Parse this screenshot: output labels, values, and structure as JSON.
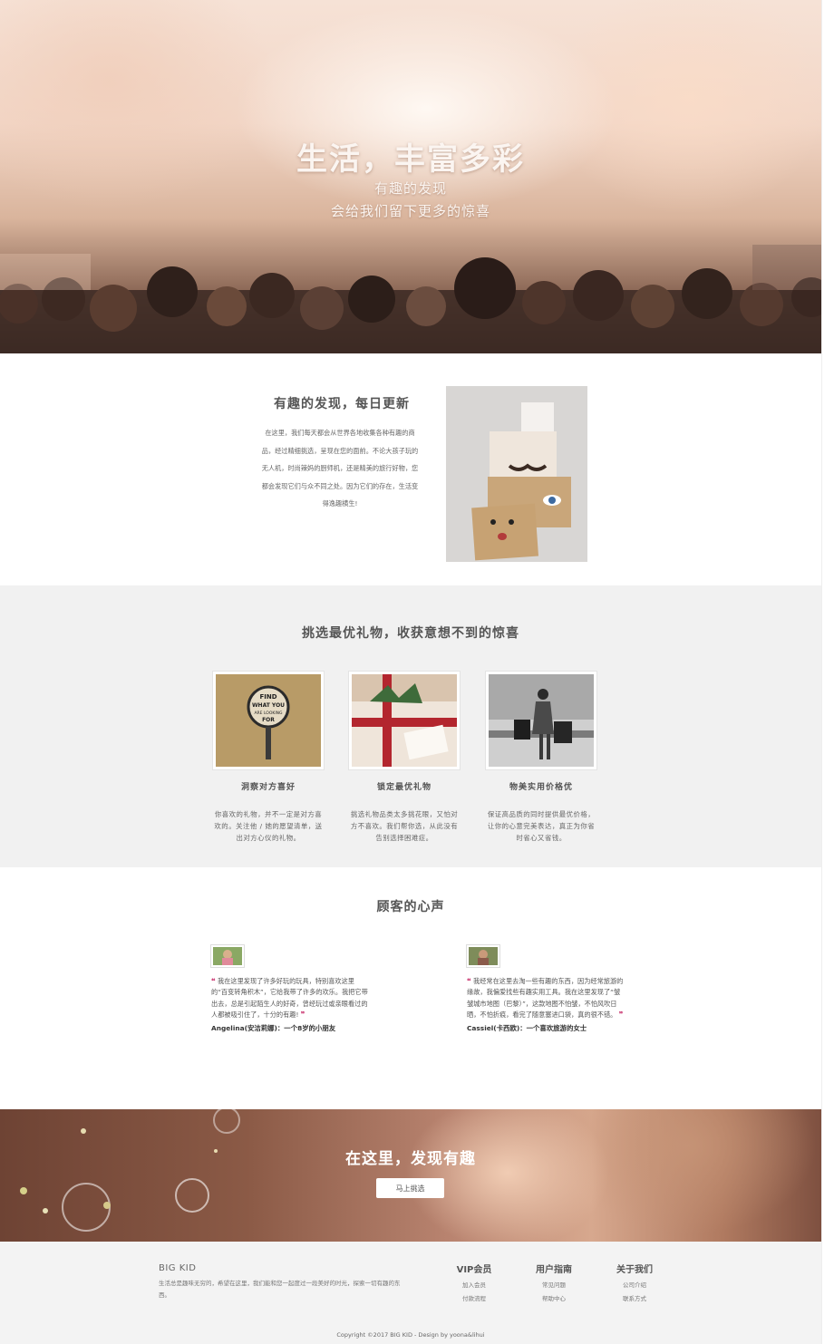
{
  "hero": {
    "title": "生活，丰富多彩",
    "subtitle_line1": "有趣的发现",
    "subtitle_line2": "会给我们留下更多的惊喜"
  },
  "daily": {
    "title": "有趣的发现，每日更新",
    "body": "在这里，我们每天都会从世界各地收集各种有趣的商品，经过精细挑选，呈现在您的面前。不论大孩子玩的无人机，时尚辣妈的厨师机，还是精美的旅行好物，您 都会发现它们与众不同之处。因为它们的存在，生活变得逸趣横生!"
  },
  "gifts": {
    "title": "挑选最优礼物，收获意想不到的惊喜",
    "cards": [
      {
        "title": "洞察对方喜好",
        "text": "你喜欢的礼物，并不一定是对方喜欢的。关注他 / 她的愿望清单，送出对方心仪的礼物。"
      },
      {
        "title": "锁定最优礼物",
        "text": "挑选礼物品类太多挑花眼，又怕对方不喜欢。我们帮你选，从此没有告别选择困难症。"
      },
      {
        "title": "物美实用价格优",
        "text": "保证高品质的同时提供最优价格，让你的心意完美表达，真正为你省时省心又省钱。"
      }
    ],
    "magnifier_text": [
      "FIND",
      "WHAT YOU",
      "ARE LOOKING",
      "FOR"
    ]
  },
  "voices": {
    "title": "顾客的心声",
    "items": [
      {
        "quote": "我在这里发现了许多好玩的玩具，特别喜欢这里的“百变转角积木”，它给我带了许多的欢乐。我把它带出去，总是引起陌生人的好奇，曾经玩过或亲眼看过的人都被吸引住了，十分的有趣!",
        "author": "Angelina(安洁莉娜)：一个8岁的小朋友"
      },
      {
        "quote": "我经常在这里去淘一些有趣的东西，因为经常旅游的缘故，我偏爱找些有趣实用工具。我在这里发现了“皱皱城市地图（巴黎）”，这款地图不怕皱，不怕风吹日晒，不怕折痕，看完了随意塞进口袋，真的很不错。",
        "author": "Cassiel(卡西欧)：一个喜欢旅游的女士"
      }
    ],
    "open_quote": "❝",
    "close_quote": "❞"
  },
  "cta": {
    "title": "在这里，发现有趣",
    "button_label": "马上挑选"
  },
  "footer": {
    "brand": "BIG KID",
    "brand_text": "生活总是趣味无穷的，希望在这里，我们能和您一起度过一段美好的时光，探索一切有趣的东西。",
    "columns": [
      {
        "title": "VIP会员",
        "links": [
          "加入会员",
          "付款流程"
        ]
      },
      {
        "title": "用户指南",
        "links": [
          "常见问题",
          "帮助中心"
        ]
      },
      {
        "title": "关于我们",
        "links": [
          "公司介绍",
          "联系方式"
        ]
      }
    ],
    "copyright": "Copyright ©2017 BIG KID - Design by yoona&lihui"
  },
  "colors": {
    "accent_quote": "#c2185b",
    "gray_section": "#f1f1f1",
    "footer_bg": "#f3f3f3"
  }
}
